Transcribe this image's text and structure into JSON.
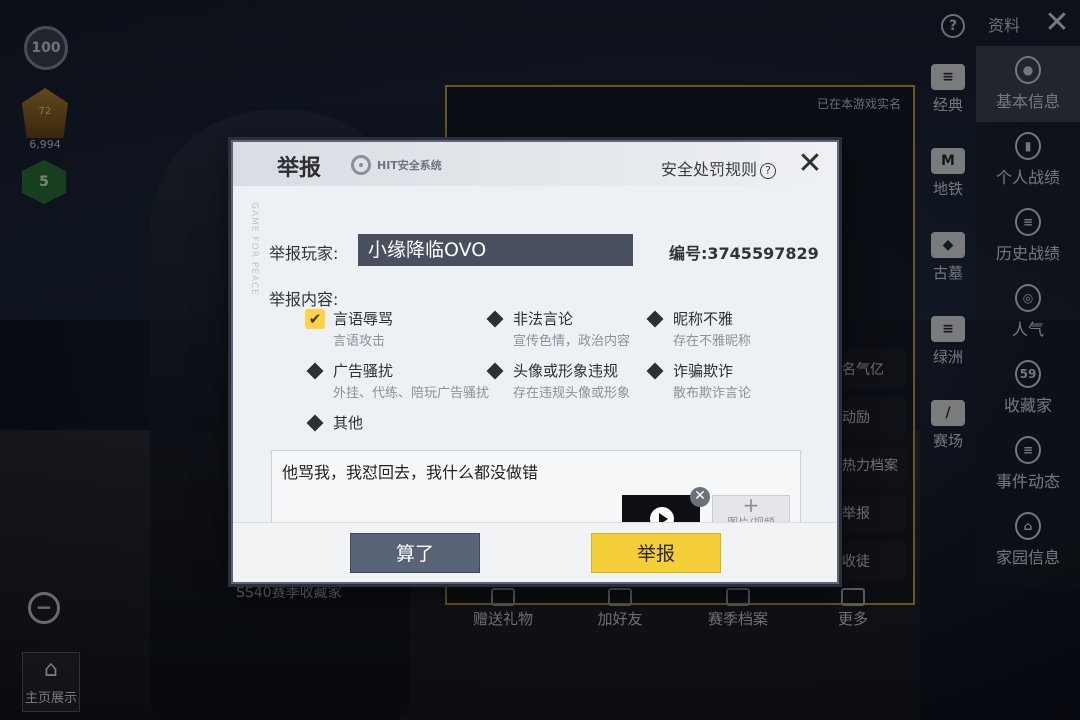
{
  "background": {
    "realname_notice": "已在本游戏实名",
    "side_list": [
      "名气亿",
      "动励",
      "热力档案",
      "举报",
      "收徒"
    ],
    "season_tag": "SS40赛季收藏家"
  },
  "hud": {
    "level": "100",
    "rank_level": "72",
    "points": "6,994",
    "badge": "5",
    "zoom_symbol": "−",
    "home_label": "主页展示"
  },
  "top_bar": {
    "help_symbol": "?",
    "tab_label": "资料",
    "close_symbol": "✕"
  },
  "modes": [
    {
      "label": "经典",
      "icon": "classic-icon",
      "glyph": "≡"
    },
    {
      "label": "地铁",
      "icon": "metro-icon",
      "glyph": "M"
    },
    {
      "label": "古墓",
      "icon": "tomb-icon",
      "glyph": "◆"
    },
    {
      "label": "绿洲",
      "icon": "oasis-icon",
      "glyph": "≡"
    },
    {
      "label": "赛场",
      "icon": "arena-icon",
      "glyph": "/"
    }
  ],
  "nav": [
    {
      "label": "基本信息",
      "icon": "user-icon",
      "glyph": "●"
    },
    {
      "label": "个人战绩",
      "icon": "stats-icon",
      "glyph": "▮"
    },
    {
      "label": "历史战绩",
      "icon": "history-icon",
      "glyph": "≡"
    },
    {
      "label": "人气",
      "icon": "popularity-icon",
      "glyph": "◎"
    },
    {
      "label": "收藏家",
      "icon": "collector-icon",
      "glyph": "59"
    },
    {
      "label": "事件动态",
      "icon": "events-icon",
      "glyph": "≡"
    },
    {
      "label": "家园信息",
      "icon": "home-info-icon",
      "glyph": "⌂"
    }
  ],
  "bottom_actions": [
    {
      "label": "赠送礼物",
      "icon": "gift-icon"
    },
    {
      "label": "加好友",
      "icon": "add-friend-icon"
    },
    {
      "label": "赛季档案",
      "icon": "season-archive-icon"
    },
    {
      "label": "更多",
      "icon": "more-icon"
    }
  ],
  "dialog": {
    "title": "举报",
    "logo_text": "HIT安全系统",
    "rules_link": "安全处罚规则",
    "rules_help": "?",
    "close_symbol": "✕",
    "vertical_label": "GAME FOR PEACE",
    "player_label": "举报玩家:",
    "player_name": "小缘降临OVO",
    "player_id_label": "编号:",
    "player_id": "3745597829",
    "content_label": "举报内容:",
    "reasons": [
      {
        "name": "言语辱骂",
        "desc": "言语攻击",
        "checked": true
      },
      {
        "name": "非法言论",
        "desc": "宣传色情，政治内容",
        "checked": false
      },
      {
        "name": "昵称不雅",
        "desc": "存在不雅昵称",
        "checked": false
      },
      {
        "name": "广告骚扰",
        "desc": "外挂、代练、陪玩广告骚扰",
        "checked": false
      },
      {
        "name": "头像或形象违规",
        "desc": "存在违规头像或形象",
        "checked": false
      },
      {
        "name": "诈骗欺诈",
        "desc": "散布欺诈言论",
        "checked": false
      },
      {
        "name": "其他",
        "desc": "",
        "checked": false
      }
    ],
    "check_mark": "✔",
    "description": "他骂我，我怼回去，我什么都没做错",
    "media_remove": "✕",
    "media_add_plus": "+",
    "media_add_label": "图片/视频",
    "cancel_label": "算了",
    "report_label": "举报"
  },
  "colors": {
    "report_button": "#f4cf3a",
    "cancel_button": "#5a6478",
    "player_name_bg": "#49505e",
    "frame_gold": "#c9a441"
  }
}
